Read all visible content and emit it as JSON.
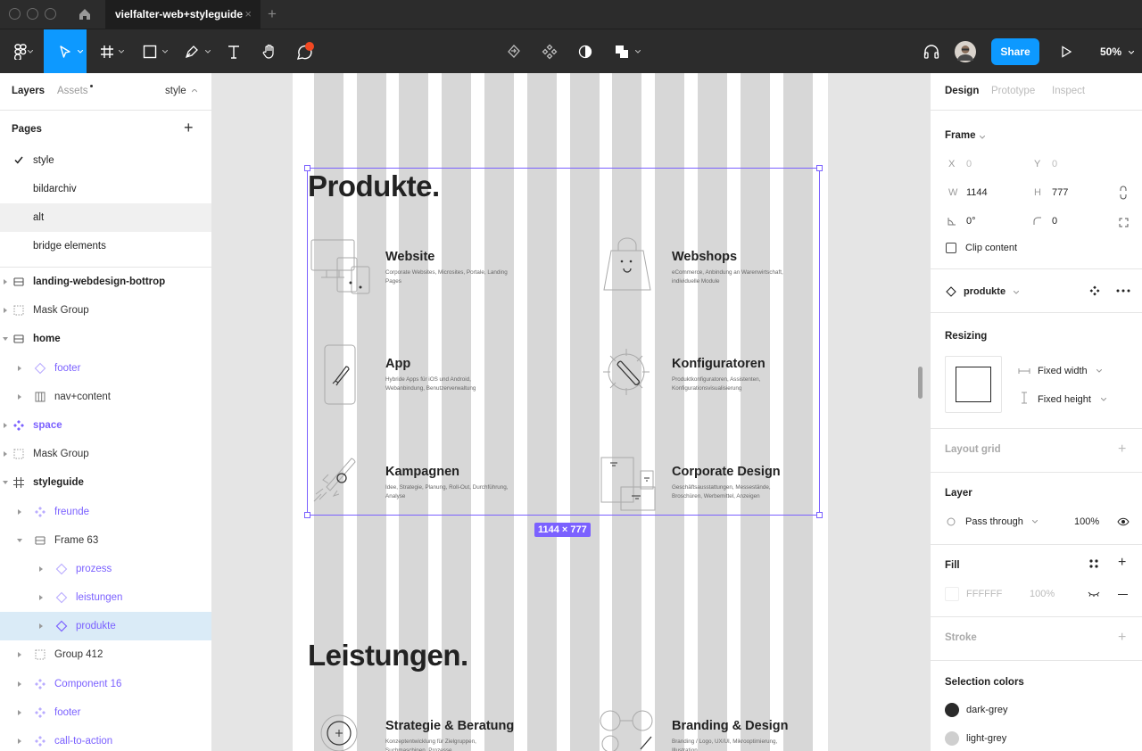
{
  "titlebar": {
    "tab_title": "vielfalter-web+styleguide",
    "tab_close": "×",
    "new_tab": "+"
  },
  "toolbar": {
    "share_label": "Share",
    "zoom_label": "50%"
  },
  "left_panel": {
    "tabs": {
      "layers": "Layers",
      "assets": "Assets",
      "page_select": "style"
    },
    "pages_header": "Pages",
    "pages_add": "+",
    "pages": [
      {
        "label": "style",
        "current": true
      },
      {
        "label": "bildarchiv"
      },
      {
        "label": "alt"
      },
      {
        "label": "bridge elements"
      }
    ],
    "layers": [
      {
        "label": "landing-webdesign-bottrop",
        "icon": "frame-icon"
      },
      {
        "label": "Mask Group",
        "icon": "group-icon"
      },
      {
        "label": "home",
        "icon": "frame-icon"
      },
      {
        "label": "footer",
        "icon": "instance-icon"
      },
      {
        "label": "nav+content",
        "icon": "columns-icon"
      },
      {
        "label": "space",
        "icon": "component-icon"
      },
      {
        "label": "Mask Group",
        "icon": "group-icon"
      },
      {
        "label": "styleguide",
        "icon": "hash-frame-icon"
      },
      {
        "label": "freunde",
        "icon": "component-icon"
      },
      {
        "label": "Frame 63",
        "icon": "frame-icon"
      },
      {
        "label": "prozess",
        "icon": "instance-icon"
      },
      {
        "label": "leistungen",
        "icon": "instance-icon"
      },
      {
        "label": "produkte",
        "icon": "instance-icon"
      },
      {
        "label": "Group 412",
        "icon": "group-icon"
      },
      {
        "label": "Component 16",
        "icon": "component-icon"
      },
      {
        "label": "footer",
        "icon": "component-icon"
      },
      {
        "label": "call-to-action",
        "icon": "component-icon"
      }
    ]
  },
  "canvas": {
    "heading_products": "Produkte.",
    "heading_services": "Leistungen.",
    "size_badge": "1144 × 777",
    "cards": [
      {
        "title": "Website",
        "desc": "Corporate Websites, Microsites, Portale, Landing Pages"
      },
      {
        "title": "Webshops",
        "desc": "eCommerce, Anbindung an Warenwirtschaft, individuelle Module"
      },
      {
        "title": "App",
        "desc": "Hybride Apps für iOS und Android, Webanbindung, Benutzerverwaltung"
      },
      {
        "title": "Konfiguratoren",
        "desc": "Produktkonfiguratoren, Assistenten, Konfigurationsvisualisierung"
      },
      {
        "title": "Kampagnen",
        "desc": "Idee, Strategie, Planung, Roll-Out, Durchführung, Analyse"
      },
      {
        "title": "Corporate Design",
        "desc": "Geschäftsausstattungen, Messestände, Broschüren, Werbemittel, Anzeigen"
      },
      {
        "title": "Strategie & Beratung",
        "desc": "Konzeptentwicklung für Zielgruppen, Suchmaschinen, Prozesse"
      },
      {
        "title": "Branding & Design",
        "desc": "Branding / Logo, UX/UI, Mikrooptimierung, Illustration"
      }
    ]
  },
  "right_panel": {
    "tabs": {
      "design": "Design",
      "prototype": "Prototype",
      "inspect": "Inspect"
    },
    "frame": {
      "header": "Frame",
      "x_label": "X",
      "x": "0",
      "y_label": "Y",
      "y": "0",
      "w_label": "W",
      "w": "1144",
      "h_label": "H",
      "h": "777",
      "rotation": "0°",
      "radius": "0",
      "clip_content": "Clip content"
    },
    "component_name": "produkte",
    "resizing": {
      "header": "Resizing",
      "width": "Fixed width",
      "height": "Fixed height"
    },
    "layout_grid": "Layout grid",
    "layer": {
      "header": "Layer",
      "blend": "Pass through",
      "opacity": "100%"
    },
    "fill": {
      "header": "Fill",
      "hex": "FFFFFF",
      "opacity": "100%"
    },
    "stroke": "Stroke",
    "selection_colors": {
      "header": "Selection colors",
      "items": [
        {
          "name": "dark-grey",
          "color": "#2a2a2a"
        },
        {
          "name": "light-grey",
          "color": "#cfcfcf"
        }
      ]
    }
  },
  "colors": {
    "accent": "#7b61ff",
    "share": "#0d99ff",
    "toolbar": "#2c2c2c",
    "selection": "#daebf7"
  }
}
